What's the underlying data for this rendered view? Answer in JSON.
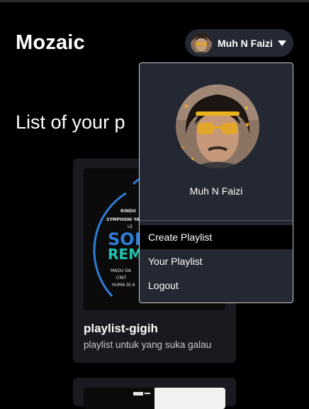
{
  "app": {
    "brand": "Mozaic"
  },
  "header": {
    "user_name": "Muh N Faizi",
    "avatar_icon": "user-avatar",
    "caret_icon": "caret-down-icon"
  },
  "main": {
    "section_title": "List of your p",
    "playlists": [
      {
        "title": "playlist-gigih",
        "description": "playlist untuk yang suka galau",
        "cover_text": [
          "RINDU",
          "SYMPHONI YA",
          "LE",
          "SON",
          "REM",
          "MADU DA",
          "CINT",
          "HUMA DI A"
        ]
      }
    ]
  },
  "dropdown": {
    "profile_name": "Muh N Faizi",
    "items": [
      {
        "label": "Create Playlist",
        "active": true
      },
      {
        "label": "Your Playlist",
        "active": false
      },
      {
        "label": "Logout",
        "active": false
      }
    ]
  },
  "colors": {
    "background": "#000000",
    "surface": "#242833",
    "card": "#181a1f",
    "accent_blue": "#2f7dd6",
    "accent_teal": "#22c3b1"
  }
}
